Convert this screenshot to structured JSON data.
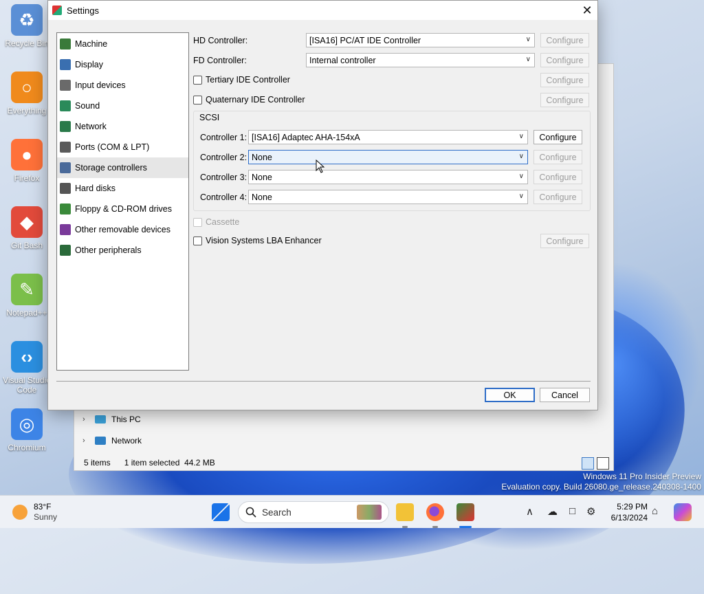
{
  "desktop": {
    "icons": [
      {
        "label": "Recycle Bin",
        "glyph": "♻",
        "color": "#5a8fd6"
      },
      {
        "label": "Everything",
        "glyph": "○",
        "color": "#f08a1c"
      },
      {
        "label": "Firefox",
        "glyph": "●",
        "color": "#ff7139"
      },
      {
        "label": "Git Bash",
        "glyph": "◆",
        "color": "#e24a3b"
      },
      {
        "label": "Notepad++",
        "glyph": "✎",
        "color": "#7bbf4a"
      },
      {
        "label": "Visual Studio Code",
        "glyph": "‹›",
        "color": "#2b8fe0"
      },
      {
        "label": "Chromium",
        "glyph": "◎",
        "color": "#3d84e6"
      }
    ]
  },
  "explorer": {
    "nav": [
      {
        "label": "This PC",
        "icon": "pc-icon"
      },
      {
        "label": "Network",
        "icon": "network-icon"
      }
    ],
    "status": {
      "items": "5 items",
      "selected": "1 item selected",
      "size": "44.2 MB"
    }
  },
  "dialog": {
    "title": "Settings",
    "close_glyph": "✕",
    "categories": [
      {
        "label": "Machine",
        "icon": "machine-icon",
        "color": "#3a7a3a",
        "selected": false
      },
      {
        "label": "Display",
        "icon": "display-icon",
        "color": "#3a6fb0",
        "selected": false
      },
      {
        "label": "Input devices",
        "icon": "input-devices-icon",
        "color": "#6a6a6a",
        "selected": false
      },
      {
        "label": "Sound",
        "icon": "sound-icon",
        "color": "#2a8a5a",
        "selected": false
      },
      {
        "label": "Network",
        "icon": "network-icon",
        "color": "#2a7a4a",
        "selected": false
      },
      {
        "label": "Ports (COM & LPT)",
        "icon": "ports-icon",
        "color": "#5a5a5a",
        "selected": false
      },
      {
        "label": "Storage controllers",
        "icon": "storage-controllers-icon",
        "color": "#4a6a9a",
        "selected": true
      },
      {
        "label": "Hard disks",
        "icon": "hard-disks-icon",
        "color": "#555555",
        "selected": false
      },
      {
        "label": "Floppy & CD-ROM drives",
        "icon": "floppy-cdrom-icon",
        "color": "#3a8a3a",
        "selected": false
      },
      {
        "label": "Other removable devices",
        "icon": "removable-devices-icon",
        "color": "#7a3a9a",
        "selected": false
      },
      {
        "label": "Other peripherals",
        "icon": "peripherals-icon",
        "color": "#2a6a3a",
        "selected": false
      }
    ],
    "hd_controller": {
      "label": "HD Controller:",
      "value": "[ISA16] PC/AT IDE Controller"
    },
    "fd_controller": {
      "label": "FD Controller:",
      "value": "Internal controller"
    },
    "tertiary_ide": {
      "label": "Tertiary IDE Controller"
    },
    "quaternary_ide": {
      "label": "Quaternary IDE Controller"
    },
    "configure_label": "Configure",
    "scsi": {
      "title": "SCSI",
      "controllers": [
        {
          "label": "Controller 1:",
          "value": "[ISA16] Adaptec AHA-154xA",
          "configurable": true
        },
        {
          "label": "Controller 2:",
          "value": "None",
          "configurable": false
        },
        {
          "label": "Controller 3:",
          "value": "None",
          "configurable": false
        },
        {
          "label": "Controller 4:",
          "value": "None",
          "configurable": false
        }
      ]
    },
    "cassette": {
      "label": "Cassette"
    },
    "vision_lba": {
      "label": "Vision Systems LBA Enhancer"
    },
    "ok_label": "OK",
    "cancel_label": "Cancel"
  },
  "watermark": {
    "line1": "Windows 11 Pro Insider Preview",
    "line2": "Evaluation copy. Build 26080.ge_release.240308-1400"
  },
  "taskbar": {
    "weather_temp": "83°F",
    "weather_desc": "Sunny",
    "search_placeholder": "Search",
    "time": "5:29 PM",
    "date": "6/13/2024"
  }
}
